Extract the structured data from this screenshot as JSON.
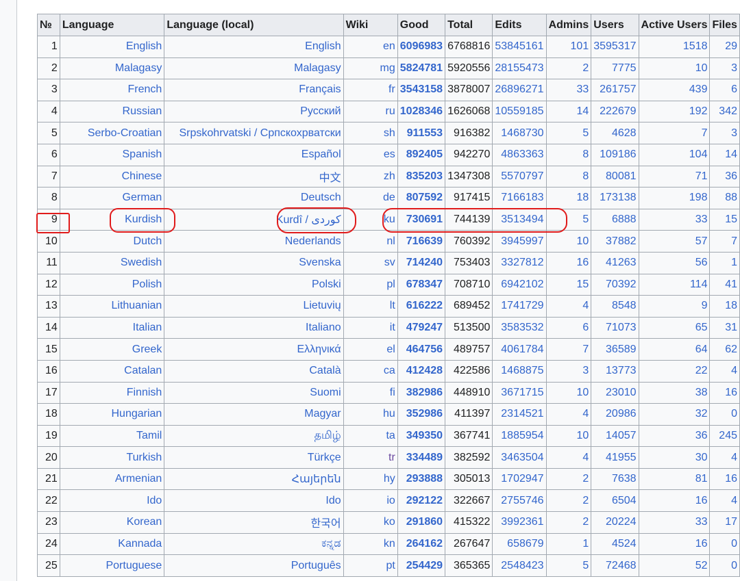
{
  "headers": {
    "rank": "№",
    "language": "Language",
    "local": "Language (local)",
    "wiki": "Wiki",
    "good": "Good",
    "total": "Total",
    "edits": "Edits",
    "admins": "Admins",
    "users": "Users",
    "active": "Active Users",
    "files": "Files"
  },
  "rows": [
    {
      "rank": "1",
      "language": "English",
      "local": "English",
      "wiki": "en",
      "good": "6096983",
      "total": "6768816",
      "edits": "53845161",
      "admins": "101",
      "users": "3595317",
      "active": "1518",
      "files": "29"
    },
    {
      "rank": "2",
      "language": "Malagasy",
      "local": "Malagasy",
      "wiki": "mg",
      "good": "5824781",
      "total": "5920556",
      "edits": "28155473",
      "admins": "2",
      "users": "7775",
      "active": "10",
      "files": "3"
    },
    {
      "rank": "3",
      "language": "French",
      "local": "Français",
      "wiki": "fr",
      "good": "3543158",
      "total": "3878007",
      "edits": "26896271",
      "admins": "33",
      "users": "261757",
      "active": "439",
      "files": "6"
    },
    {
      "rank": "4",
      "language": "Russian",
      "local": "Русский",
      "wiki": "ru",
      "good": "1028346",
      "total": "1626068",
      "edits": "10559185",
      "admins": "14",
      "users": "222679",
      "active": "192",
      "files": "342"
    },
    {
      "rank": "5",
      "language": "Serbo-Croatian",
      "local": "Srpskohrvatski / Српскохрватски",
      "wiki": "sh",
      "good": "911553",
      "total": "916382",
      "edits": "1468730",
      "admins": "5",
      "users": "4628",
      "active": "7",
      "files": "3"
    },
    {
      "rank": "6",
      "language": "Spanish",
      "local": "Español",
      "wiki": "es",
      "good": "892405",
      "total": "942270",
      "edits": "4863363",
      "admins": "8",
      "users": "109186",
      "active": "104",
      "files": "14"
    },
    {
      "rank": "7",
      "language": "Chinese",
      "local": "中文",
      "wiki": "zh",
      "good": "835203",
      "total": "1347308",
      "edits": "5570797",
      "admins": "8",
      "users": "80081",
      "active": "71",
      "files": "36"
    },
    {
      "rank": "8",
      "language": "German",
      "local": "Deutsch",
      "wiki": "de",
      "good": "807592",
      "total": "917415",
      "edits": "7166183",
      "admins": "18",
      "users": "173138",
      "active": "198",
      "files": "88"
    },
    {
      "rank": "9",
      "language": "Kurdish",
      "local": "Kurdî / کوردی",
      "wiki": "ku",
      "good": "730691",
      "total": "744139",
      "edits": "3513494",
      "admins": "5",
      "users": "6888",
      "active": "33",
      "files": "15"
    },
    {
      "rank": "10",
      "language": "Dutch",
      "local": "Nederlands",
      "wiki": "nl",
      "good": "716639",
      "total": "760392",
      "edits": "3945997",
      "admins": "10",
      "users": "37882",
      "active": "57",
      "files": "7"
    },
    {
      "rank": "11",
      "language": "Swedish",
      "local": "Svenska",
      "wiki": "sv",
      "good": "714240",
      "total": "753403",
      "edits": "3327812",
      "admins": "16",
      "users": "41263",
      "active": "56",
      "files": "1"
    },
    {
      "rank": "12",
      "language": "Polish",
      "local": "Polski",
      "wiki": "pl",
      "good": "678347",
      "total": "708710",
      "edits": "6942102",
      "admins": "15",
      "users": "70392",
      "active": "114",
      "files": "41"
    },
    {
      "rank": "13",
      "language": "Lithuanian",
      "local": "Lietuvių",
      "wiki": "lt",
      "good": "616222",
      "total": "689452",
      "edits": "1741729",
      "admins": "4",
      "users": "8548",
      "active": "9",
      "files": "18"
    },
    {
      "rank": "14",
      "language": "Italian",
      "local": "Italiano",
      "wiki": "it",
      "good": "479247",
      "total": "513500",
      "edits": "3583532",
      "admins": "6",
      "users": "71073",
      "active": "65",
      "files": "31"
    },
    {
      "rank": "15",
      "language": "Greek",
      "local": "Ελληνικά",
      "wiki": "el",
      "good": "464756",
      "total": "489757",
      "edits": "4061784",
      "admins": "7",
      "users": "36589",
      "active": "64",
      "files": "62"
    },
    {
      "rank": "16",
      "language": "Catalan",
      "local": "Català",
      "wiki": "ca",
      "good": "412428",
      "total": "422586",
      "edits": "1468875",
      "admins": "3",
      "users": "13773",
      "active": "22",
      "files": "4"
    },
    {
      "rank": "17",
      "language": "Finnish",
      "local": "Suomi",
      "wiki": "fi",
      "good": "382986",
      "total": "448910",
      "edits": "3671715",
      "admins": "10",
      "users": "23010",
      "active": "38",
      "files": "16"
    },
    {
      "rank": "18",
      "language": "Hungarian",
      "local": "Magyar",
      "wiki": "hu",
      "good": "352986",
      "total": "411397",
      "edits": "2314521",
      "admins": "4",
      "users": "20986",
      "active": "32",
      "files": "0"
    },
    {
      "rank": "19",
      "language": "Tamil",
      "local": "தமிழ்",
      "wiki": "ta",
      "good": "349350",
      "total": "367741",
      "edits": "1885954",
      "admins": "10",
      "users": "14057",
      "active": "36",
      "files": "245"
    },
    {
      "rank": "20",
      "language": "Turkish",
      "local": "Türkçe",
      "wiki": "tr",
      "good": "334489",
      "total": "382592",
      "edits": "3463504",
      "admins": "4",
      "users": "41955",
      "active": "30",
      "files": "4"
    },
    {
      "rank": "21",
      "language": "Armenian",
      "local": "Հայերեն",
      "wiki": "hy",
      "good": "293888",
      "total": "305013",
      "edits": "1702947",
      "admins": "2",
      "users": "7638",
      "active": "81",
      "files": "16"
    },
    {
      "rank": "22",
      "language": "Ido",
      "local": "Ido",
      "wiki": "io",
      "good": "292122",
      "total": "322667",
      "edits": "2755746",
      "admins": "2",
      "users": "6504",
      "active": "16",
      "files": "4"
    },
    {
      "rank": "23",
      "language": "Korean",
      "local": "한국어",
      "wiki": "ko",
      "good": "291860",
      "total": "415322",
      "edits": "3992361",
      "admins": "2",
      "users": "20224",
      "active": "33",
      "files": "17"
    },
    {
      "rank": "24",
      "language": "Kannada",
      "local": "ಕನ್ನಡ",
      "wiki": "kn",
      "good": "264162",
      "total": "267647",
      "edits": "658679",
      "admins": "1",
      "users": "4524",
      "active": "16",
      "files": "0"
    },
    {
      "rank": "25",
      "language": "Portuguese",
      "local": "Português",
      "wiki": "pt",
      "good": "254429",
      "total": "365365",
      "edits": "2548423",
      "admins": "5",
      "users": "72468",
      "active": "52",
      "files": "0"
    }
  ],
  "colors": {
    "link": "#3366cc",
    "visited_link": "#6b4ba1",
    "header_bg": "#eaecf0",
    "cell_bg": "#f8f9fa",
    "border": "#a2a9b1",
    "annotation": "#e01b1b"
  }
}
